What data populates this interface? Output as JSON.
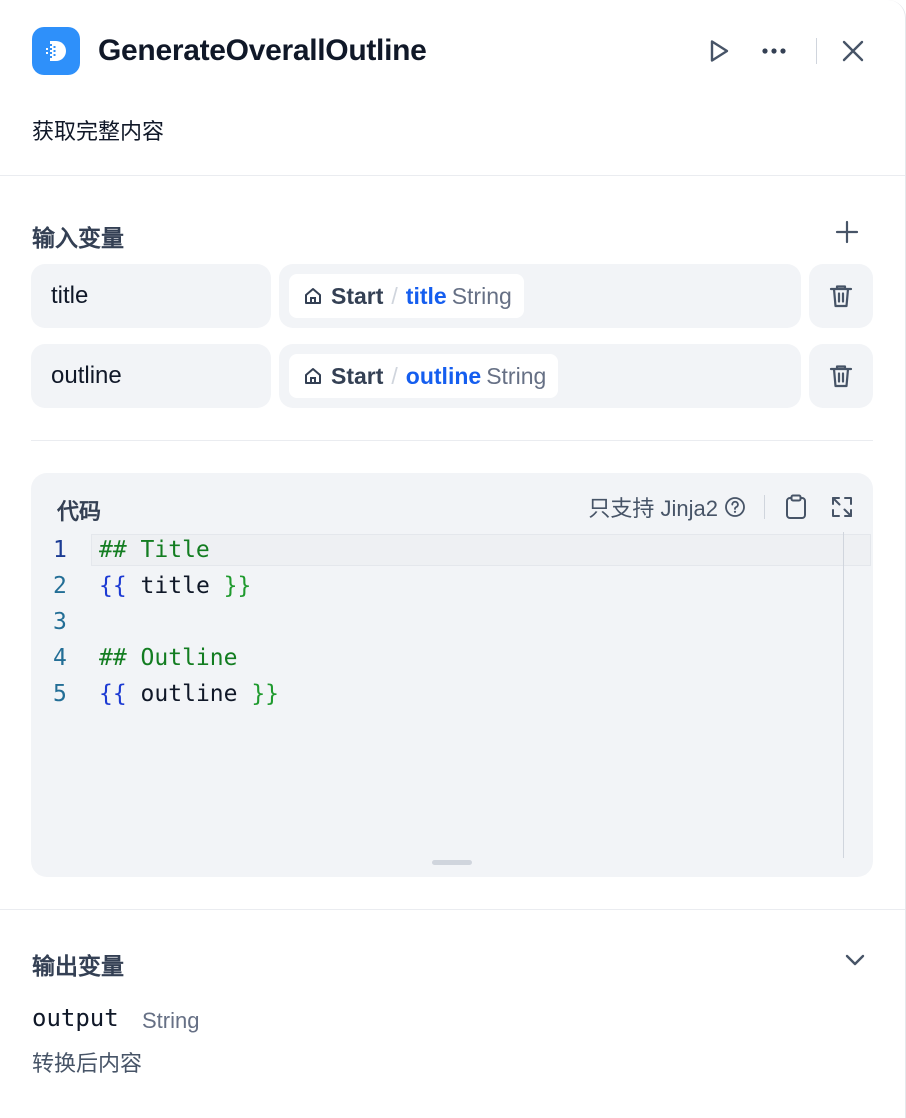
{
  "header": {
    "title": "GenerateOverallOutline",
    "description": "获取完整内容",
    "icons": [
      "app-logo-icon",
      "run-icon",
      "more-icon",
      "close-icon"
    ]
  },
  "input_vars": {
    "section_title": "输入变量",
    "rows": [
      {
        "name": "title",
        "node": "Start",
        "separator": "/",
        "var": "title",
        "type": "String"
      },
      {
        "name": "outline",
        "node": "Start",
        "separator": "/",
        "var": "outline",
        "type": "String"
      }
    ]
  },
  "code": {
    "label": "代码",
    "hint": "只支持 Jinja2",
    "line_numbers": [
      "1",
      "2",
      "3",
      "4",
      "5"
    ],
    "lines": [
      {
        "head": "## Title"
      },
      {
        "open": "{{",
        "expr": " title ",
        "close": "}}"
      },
      {
        "text": ""
      },
      {
        "head": "## Outline"
      },
      {
        "open": "{{",
        "expr": " outline ",
        "close": "}}"
      }
    ]
  },
  "output_vars": {
    "section_title": "输出变量",
    "name": "output",
    "type": "String",
    "description": "转换后内容"
  },
  "colors": {
    "accent": "#2e90fa",
    "var_link": "#155eef",
    "heading_green": "#137d21",
    "brace_blue": "#1c3ad3"
  }
}
